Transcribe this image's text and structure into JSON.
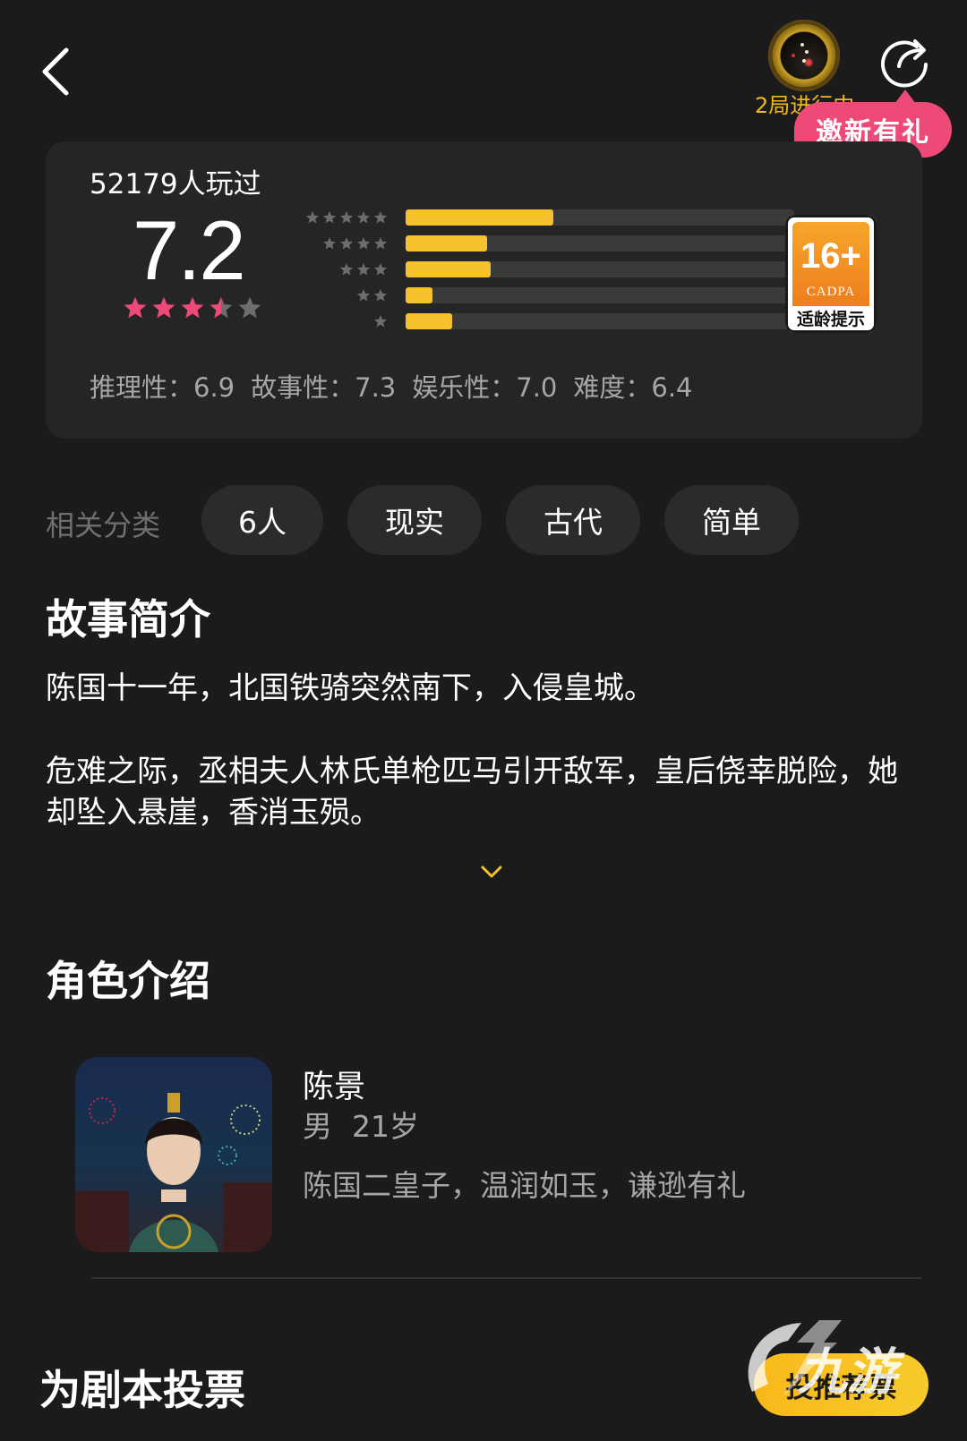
{
  "header": {
    "progress_label": "2局进行中",
    "invite_label": "邀新有礼",
    "icons": {
      "back": "back-arrow-icon",
      "share": "share-icon"
    }
  },
  "rating": {
    "played_count": "52179人玩过",
    "score": "7.2",
    "score_stars": 3.5,
    "distribution": [
      {
        "stars": 5,
        "fraction": 0.38
      },
      {
        "stars": 4,
        "fraction": 0.21
      },
      {
        "stars": 3,
        "fraction": 0.22
      },
      {
        "stars": 2,
        "fraction": 0.07
      },
      {
        "stars": 1,
        "fraction": 0.12
      }
    ],
    "age_badge": {
      "age": "16+",
      "org": "CADPA",
      "tip": "适龄提示"
    },
    "dimensions": [
      {
        "label": "推理性：6.9"
      },
      {
        "label": "故事性：7.3"
      },
      {
        "label": "娱乐性：7.0"
      },
      {
        "label": "难度：6.4"
      }
    ],
    "colors": {
      "bar_fill": "#f6c22b",
      "star_active": "#ee4a78",
      "star_inactive": "#6d6d6e"
    }
  },
  "tags": {
    "label": "相关分类",
    "items": [
      "6人",
      "现实",
      "古代",
      "简单"
    ]
  },
  "story": {
    "title": "故事简介",
    "paragraph1": "陈国十一年，北国铁骑突然南下，入侵皇城。",
    "paragraph2": "危难之际，丞相夫人林氏单枪匹马引开敌军，皇后侥幸脱险，她却坠入悬崖，香消玉殒。",
    "expand_icon": "chevron-down-icon"
  },
  "characters": {
    "title": "角色介绍",
    "items": [
      {
        "name": "陈景",
        "gender": "男",
        "age": "21岁",
        "desc": "陈国二皇子，温润如玉，谦逊有礼"
      }
    ]
  },
  "vote": {
    "title": "为剧本投票",
    "button_label": "投推荐票",
    "watermark": "九游"
  }
}
